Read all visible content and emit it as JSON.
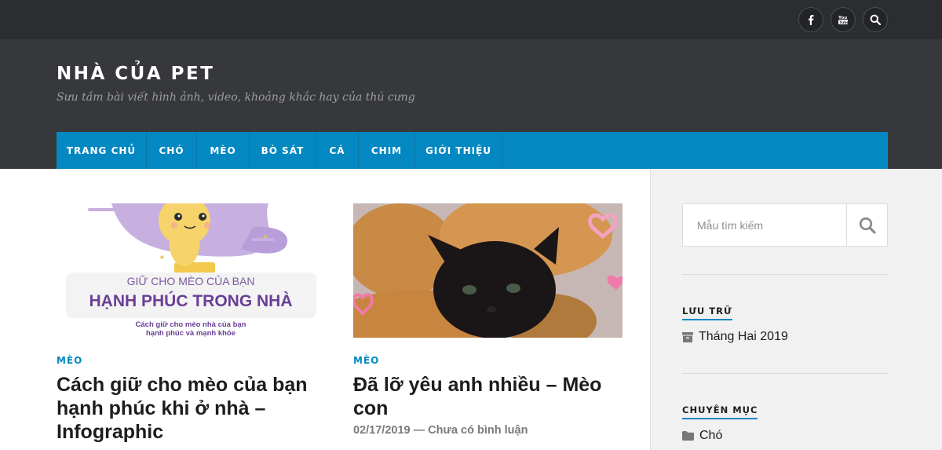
{
  "social": [
    {
      "icon": "facebook-icon"
    },
    {
      "icon": "youtube-icon"
    },
    {
      "icon": "search-icon"
    }
  ],
  "site": {
    "title": "NHÀ CỦA PET",
    "description": "Sưu tầm bài viết hình ảnh, video, khoảng khắc hay của thú cưng"
  },
  "nav": {
    "items": [
      {
        "label": "TRANG CHỦ"
      },
      {
        "label": "CHÓ"
      },
      {
        "label": "MÈO"
      },
      {
        "label": "BÒ SÁT"
      },
      {
        "label": "CÁ"
      },
      {
        "label": "CHIM"
      },
      {
        "label": "GIỚI THIỆU"
      }
    ]
  },
  "posts": [
    {
      "category": "MÈO",
      "title": "Cách giữ cho mèo của bạn hạnh phúc khi ở nhà – Infographic",
      "image": {
        "line1": "GIỮ CHO MÈO CỦA BẠN",
        "line2": "HẠNH PHÚC TRONG NHÀ",
        "line3": "Cách giữ cho mèo nhà của bạn",
        "line4": "hạnh phúc và mạnh khỏe"
      }
    },
    {
      "category": "MÈO",
      "title": "Đã lỡ yêu anh nhiều – Mèo con",
      "meta": "02/17/2019 — Chưa có bình luận"
    }
  ],
  "sidebar": {
    "search_placeholder": "Mẫu tìm kiếm",
    "archives": {
      "title": "LƯU TRỮ",
      "items": [
        {
          "label": "Tháng Hai 2019",
          "icon": "archive-icon"
        }
      ]
    },
    "categories": {
      "title": "CHUYÊN MỤC",
      "items": [
        {
          "label": "Chó",
          "icon": "folder-icon"
        }
      ]
    }
  },
  "colors": {
    "topbar": "#2c2d30",
    "header": "#37383c",
    "accent": "#0488c1",
    "sidebar": "#f1f1f1"
  }
}
